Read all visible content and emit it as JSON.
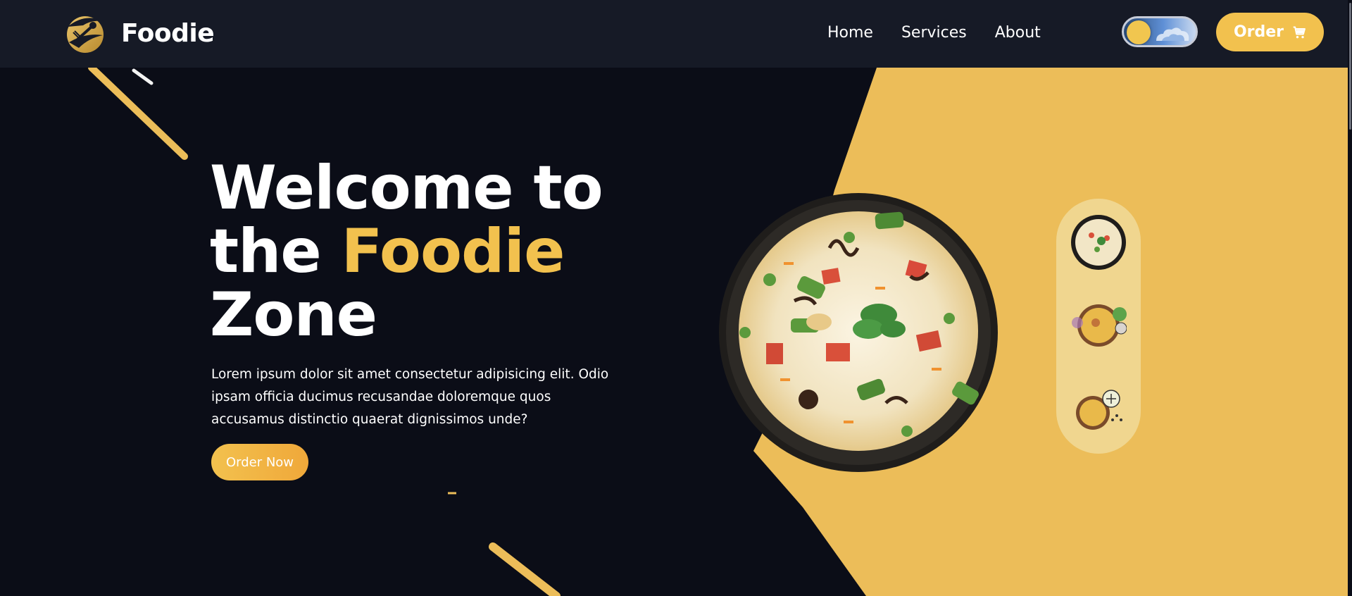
{
  "brand": {
    "name": "Foodie",
    "logo_icon": "fork-spoon-swirl-logo"
  },
  "nav": {
    "links": [
      "Home",
      "Services",
      "About"
    ]
  },
  "theme_toggle": {
    "icon": "sun-cloud-toggle"
  },
  "order_button": {
    "label": "Order",
    "icon": "cart-icon"
  },
  "hero": {
    "title_line1": "Welcome to",
    "title_line2_prefix": "the ",
    "title_line2_accent": "Foodie",
    "title_line3": "Zone",
    "description": "Lorem ipsum dolor sit amet consectetur adipisicing elit. Odio ipsam officia ducimus recusandae doloremque quos accusamus distinctio quaerat dignissimos unde?",
    "cta_label": "Order Now"
  },
  "dishes": {
    "main": "biryani-bowl-image",
    "thumbnails": [
      "biryani-bowl-thumb",
      "biryani-plate-thumb",
      "biryani-plate-lime-thumb"
    ]
  },
  "colors": {
    "accent": "#f2c14e",
    "navbar_bg": "#161a26",
    "page_bg": "#0b0d17",
    "hero_panel": "#ecbd59",
    "thumb_panel": "#f0d68f"
  }
}
